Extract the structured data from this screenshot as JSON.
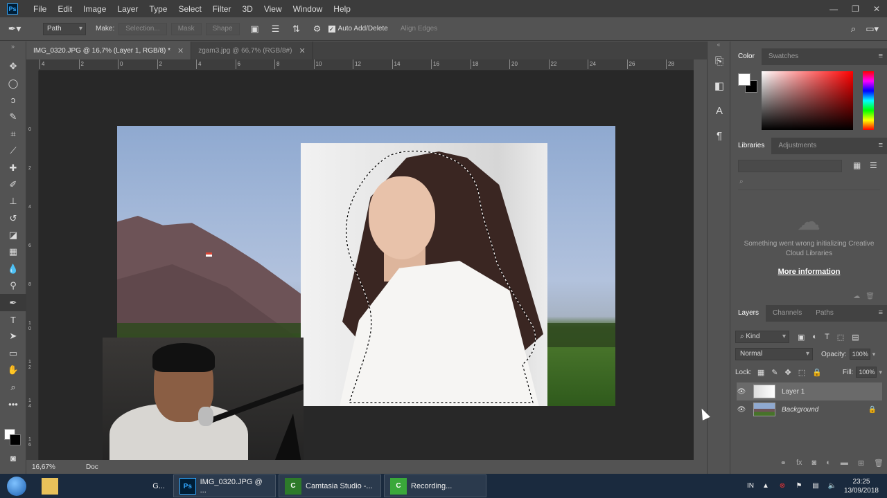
{
  "menubar": {
    "logo": "Ps",
    "items": [
      "File",
      "Edit",
      "Image",
      "Layer",
      "Type",
      "Select",
      "Filter",
      "3D",
      "View",
      "Window",
      "Help"
    ],
    "window_controls": [
      "—",
      "❐",
      "✕"
    ]
  },
  "options": {
    "mode": "Path",
    "make_label": "Make:",
    "selection_btn": "Selection...",
    "mask_btn": "Mask",
    "shape_btn": "Shape",
    "auto_add_delete": "Auto Add/Delete",
    "auto_add_delete_checked": true,
    "align_edges": "Align Edges"
  },
  "tabs": [
    {
      "title": "IMG_0320.JPG @ 16,7% (Layer 1, RGB/8) *",
      "active": true
    },
    {
      "title": "zgam3.jpg @ 66,7% (RGB/8#)",
      "active": false
    }
  ],
  "ruler": {
    "h_ticks": [
      "4",
      "2",
      "0",
      "2",
      "4",
      "6",
      "8",
      "10",
      "12",
      "14",
      "16",
      "18",
      "20",
      "22",
      "24",
      "26",
      "28"
    ],
    "v_ticks": [
      "0",
      "2",
      "4",
      "6",
      "8",
      "1\n0",
      "1\n2",
      "1\n4",
      "1\n6"
    ]
  },
  "status": {
    "zoom": "16,67%",
    "doc": "Doc"
  },
  "color_panel": {
    "tabs": [
      "Color",
      "Swatches"
    ],
    "fg": "#ffffff",
    "bg": "#000000"
  },
  "libraries": {
    "tabs": [
      "Libraries",
      "Adjustments"
    ],
    "message": "Something went wrong initializing Creative Cloud Libraries",
    "link": "More information"
  },
  "layers": {
    "tabs": [
      "Layers",
      "Channels",
      "Paths"
    ],
    "kind": "Kind",
    "blend_mode": "Normal",
    "opacity_label": "Opacity:",
    "opacity": "100%",
    "lock_label": "Lock:",
    "fill_label": "Fill:",
    "fill": "100%",
    "items": [
      {
        "name": "Layer 1",
        "selected": true
      },
      {
        "name": "Background",
        "selected": false
      }
    ]
  },
  "taskbar": {
    "apps": [
      "G...",
      "IMG_0320.JPG @ ...",
      "Camtasia Studio -...",
      "Recording..."
    ],
    "lang": "IN",
    "time": "23:25",
    "date": "13/09/2018"
  }
}
